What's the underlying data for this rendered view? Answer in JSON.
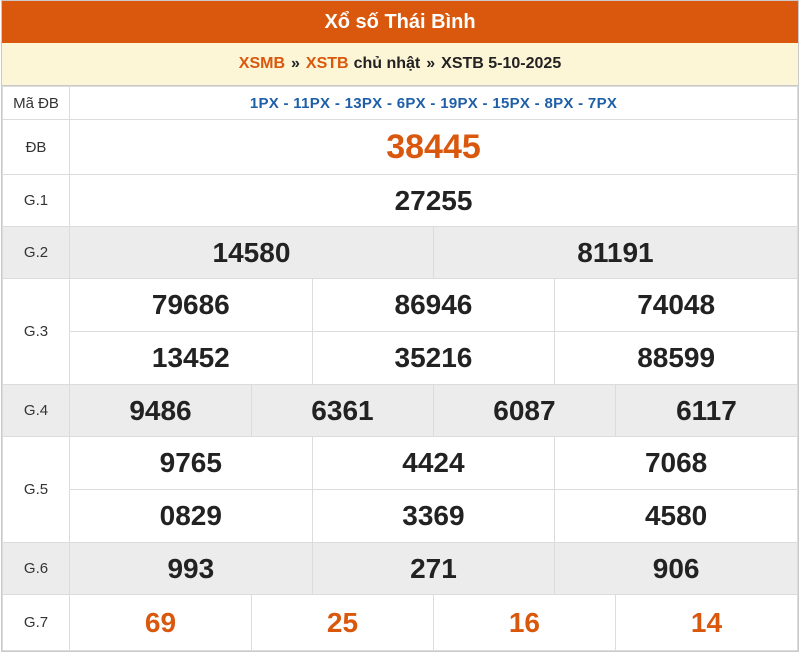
{
  "title": "Xổ số Thái Bình",
  "breadcrumb": {
    "link1": "XSMB",
    "sep1": "»",
    "link2": "XSTB",
    "day": "chủ nhật",
    "sep2": "»",
    "current": "XSTB 5-10-2025"
  },
  "colors": {
    "header": "#d9580d",
    "crumb_bg": "#fcf5d6",
    "codes": "#1f5fa8",
    "gray_row": "#ececec"
  },
  "ma_db": {
    "label": "Mã ĐB",
    "codes": "1PX - 11PX - 13PX - 6PX - 19PX - 15PX - 8PX - 7PX"
  },
  "prizes": {
    "db": {
      "label": "ĐB",
      "values": [
        "38445"
      ]
    },
    "g1": {
      "label": "G.1",
      "values": [
        "27255"
      ]
    },
    "g2": {
      "label": "G.2",
      "values": [
        "14580",
        "81191"
      ]
    },
    "g3": {
      "label": "G.3",
      "values": [
        "79686",
        "86946",
        "74048",
        "13452",
        "35216",
        "88599"
      ]
    },
    "g4": {
      "label": "G.4",
      "values": [
        "9486",
        "6361",
        "6087",
        "6117"
      ]
    },
    "g5": {
      "label": "G.5",
      "values": [
        "9765",
        "4424",
        "7068",
        "0829",
        "3369",
        "4580"
      ]
    },
    "g6": {
      "label": "G.6",
      "values": [
        "993",
        "271",
        "906"
      ]
    },
    "g7": {
      "label": "G.7",
      "values": [
        "69",
        "25",
        "16",
        "14"
      ]
    }
  }
}
